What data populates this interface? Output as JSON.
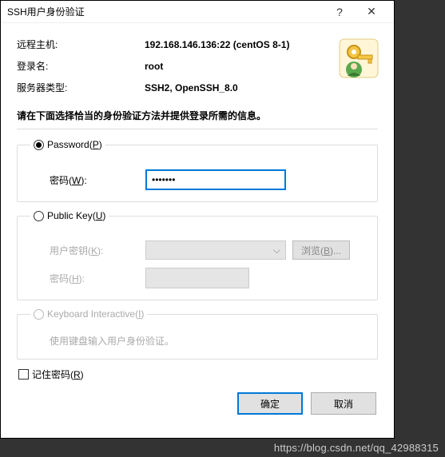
{
  "titlebar": {
    "title": "SSH用户身份验证",
    "help": "?",
    "close": "✕"
  },
  "info": {
    "host_label": "远程主机:",
    "host_value": "192.168.146.136:22 (centOS 8-1)",
    "login_label": "登录名:",
    "login_value": "root",
    "server_label": "服务器类型:",
    "server_value": "SSH2, OpenSSH_8.0"
  },
  "instruction": "请在下面选择恰当的身份验证方法并提供登录所需的信息。",
  "password_group": {
    "legend_prefix": "Password(",
    "legend_key": "P",
    "legend_suffix": ")",
    "pwd_label_prefix": "密码(",
    "pwd_label_key": "W",
    "pwd_label_suffix": "):",
    "pwd_value": "•••••••"
  },
  "publickey_group": {
    "legend_prefix": "Public Key(",
    "legend_key": "U",
    "legend_suffix": ")",
    "userkey_label_prefix": "用户密钥(",
    "userkey_label_key": "K",
    "userkey_label_suffix": "):",
    "browse_prefix": "浏览(",
    "browse_key": "B",
    "browse_suffix": ")...",
    "pass_label_prefix": "密码(",
    "pass_label_key": "H",
    "pass_label_suffix": "):",
    "combo_arrow": "⌵"
  },
  "keyboard_group": {
    "legend_prefix": "Keyboard Interactive(",
    "legend_key": "I",
    "legend_suffix": ")",
    "hint": "使用键盘输入用户身份验证。"
  },
  "remember": {
    "label_prefix": "记住密码(",
    "label_key": "R",
    "label_suffix": ")"
  },
  "buttons": {
    "ok": "确定",
    "cancel": "取消"
  },
  "watermark": "https://blog.csdn.net/qq_42988315"
}
